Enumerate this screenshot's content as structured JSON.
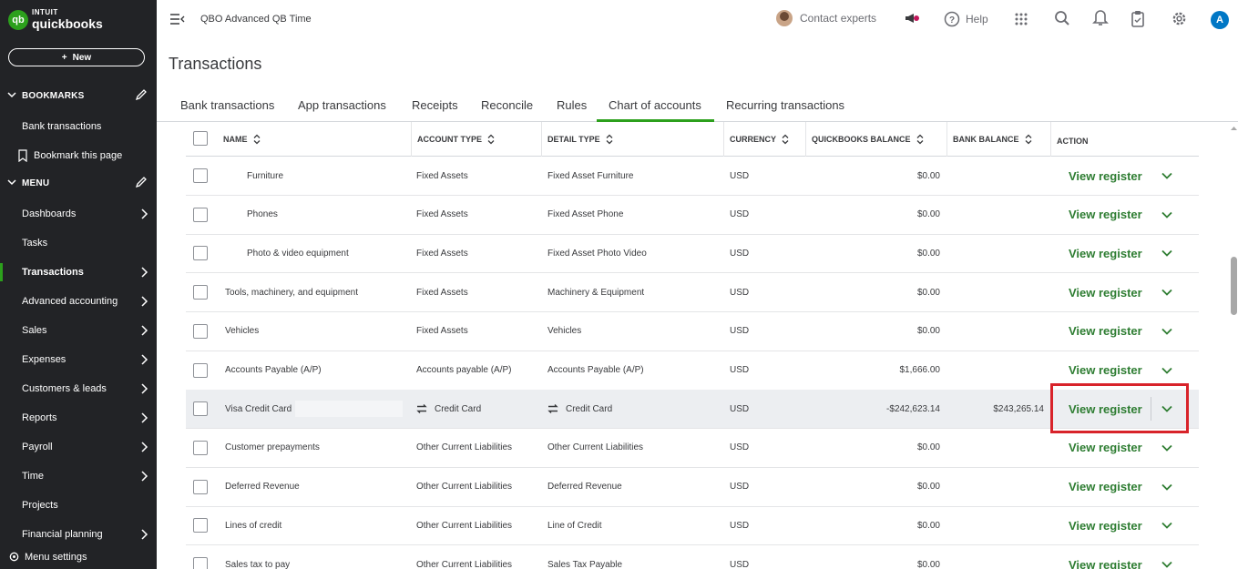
{
  "app": {
    "logo_line1": "INTUIT",
    "logo_line2": "quickbooks",
    "new_label": "New",
    "company": "QBO Advanced QB Time",
    "contact_label": "Contact experts",
    "help_label": "Help",
    "user_initial": "A"
  },
  "sidebar": {
    "bookmarks_title": "BOOKMARKS",
    "bookmark_items": [
      "Bank transactions",
      "Bookmark this page"
    ],
    "menu_title": "MENU",
    "menu_items": [
      {
        "label": "Dashboards",
        "arrow": true
      },
      {
        "label": "Tasks",
        "arrow": false
      },
      {
        "label": "Transactions",
        "arrow": true
      },
      {
        "label": "Advanced accounting",
        "arrow": true
      },
      {
        "label": "Sales",
        "arrow": true
      },
      {
        "label": "Expenses",
        "arrow": true
      },
      {
        "label": "Customers & leads",
        "arrow": true
      },
      {
        "label": "Reports",
        "arrow": true
      },
      {
        "label": "Payroll",
        "arrow": true
      },
      {
        "label": "Time",
        "arrow": true
      },
      {
        "label": "Projects",
        "arrow": false
      },
      {
        "label": "Financial planning",
        "arrow": true
      }
    ],
    "active_item": "Transactions",
    "menu_settings": "Menu settings"
  },
  "page": {
    "title": "Transactions",
    "tabs": [
      "Bank transactions",
      "App transactions",
      "Receipts",
      "Reconcile",
      "Rules",
      "Chart of accounts",
      "Recurring transactions"
    ],
    "active_tab": "Chart of accounts"
  },
  "table": {
    "headers": {
      "name": "NAME",
      "account_type": "ACCOUNT TYPE",
      "detail_type": "DETAIL TYPE",
      "currency": "CURRENCY",
      "qb_balance": "QUICKBOOKS BALANCE",
      "bank_balance": "BANK BALANCE",
      "action": "ACTION"
    },
    "action_label": "View register",
    "rows": [
      {
        "name": "Furniture",
        "indent": true,
        "account_type": "Fixed Assets",
        "detail_type": "Fixed Asset Furniture",
        "currency": "USD",
        "qb_balance": "$0.00",
        "bank_balance": ""
      },
      {
        "name": "Phones",
        "indent": true,
        "account_type": "Fixed Assets",
        "detail_type": "Fixed Asset Phone",
        "currency": "USD",
        "qb_balance": "$0.00",
        "bank_balance": ""
      },
      {
        "name": "Photo & video equipment",
        "indent": true,
        "account_type": "Fixed Assets",
        "detail_type": "Fixed Asset Photo Video",
        "currency": "USD",
        "qb_balance": "$0.00",
        "bank_balance": ""
      },
      {
        "name": "Tools, machinery, and equipment",
        "indent": false,
        "account_type": "Fixed Assets",
        "detail_type": "Machinery & Equipment",
        "currency": "USD",
        "qb_balance": "$0.00",
        "bank_balance": ""
      },
      {
        "name": "Vehicles",
        "indent": false,
        "account_type": "Fixed Assets",
        "detail_type": "Vehicles",
        "currency": "USD",
        "qb_balance": "$0.00",
        "bank_balance": ""
      },
      {
        "name": "Accounts Payable (A/P)",
        "indent": false,
        "account_type": "Accounts payable (A/P)",
        "detail_type": "Accounts Payable (A/P)",
        "currency": "USD",
        "qb_balance": "$1,666.00",
        "bank_balance": ""
      },
      {
        "name": "Visa Credit Card",
        "indent": false,
        "account_type": "Credit Card",
        "detail_type": "Credit Card",
        "currency": "USD",
        "qb_balance": "-$242,623.14",
        "bank_balance": "$243,265.14",
        "highlight": true,
        "synced": true
      },
      {
        "name": "Customer prepayments",
        "indent": false,
        "account_type": "Other Current Liabilities",
        "detail_type": "Other Current Liabilities",
        "currency": "USD",
        "qb_balance": "$0.00",
        "bank_balance": ""
      },
      {
        "name": "Deferred Revenue",
        "indent": false,
        "account_type": "Other Current Liabilities",
        "detail_type": "Deferred Revenue",
        "currency": "USD",
        "qb_balance": "$0.00",
        "bank_balance": ""
      },
      {
        "name": "Lines of credit",
        "indent": false,
        "account_type": "Other Current Liabilities",
        "detail_type": "Line of Credit",
        "currency": "USD",
        "qb_balance": "$0.00",
        "bank_balance": ""
      },
      {
        "name": "Sales tax to pay",
        "indent": false,
        "account_type": "Other Current Liabilities",
        "detail_type": "Sales Tax Payable",
        "currency": "USD",
        "qb_balance": "$0.00",
        "bank_balance": ""
      }
    ]
  },
  "colors": {
    "sidebar_bg": "#222326",
    "brand_green": "#2ca01c",
    "action_green": "#2e7d32",
    "highlight_red": "#d8232a"
  }
}
